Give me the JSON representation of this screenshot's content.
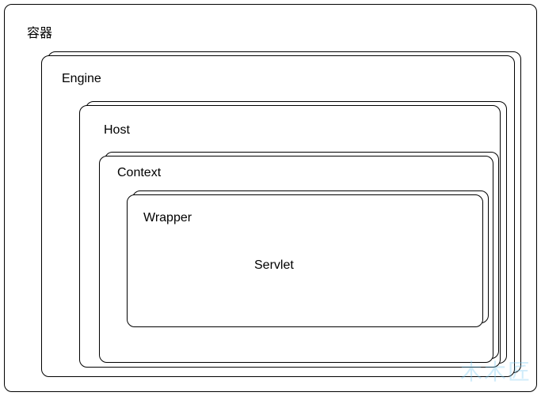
{
  "diagram": {
    "container_label": "容器",
    "engine_label": "Engine",
    "host_label": "Host",
    "context_label": "Context",
    "wrapper_label": "Wrapper",
    "servlet_label": "Servlet"
  },
  "watermark": "木木匠"
}
